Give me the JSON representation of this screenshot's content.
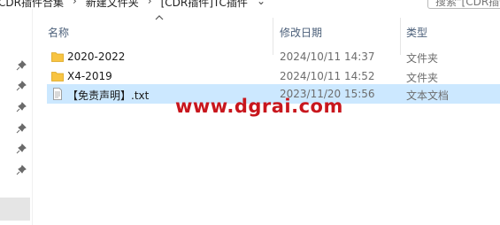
{
  "breadcrumb": [
    "CDR插件合集",
    "新建文件夹",
    "[CDR插件]TC插件"
  ],
  "search": {
    "placeholder": "搜索\"[CDR插件]\""
  },
  "columns": {
    "name": "名称",
    "date": "修改日期",
    "type": "类型"
  },
  "files": [
    {
      "name": "2020-2022",
      "date": "2024/10/11 14:37",
      "type": "文件夹",
      "icon": "folder-icon"
    },
    {
      "name": "X4-2019",
      "date": "2024/10/11 14:52",
      "type": "文件夹",
      "icon": "folder-icon"
    },
    {
      "name": "【免责声明】.txt",
      "date": "2023/11/20 15:56",
      "type": "文本文档",
      "icon": "text-file-icon"
    }
  ],
  "watermark": "www.dgrai.com",
  "colors": {
    "selection": "#cce8ff",
    "folder": "#f8c442",
    "header_text": "#4c607a",
    "watermark": "#c8161d"
  }
}
